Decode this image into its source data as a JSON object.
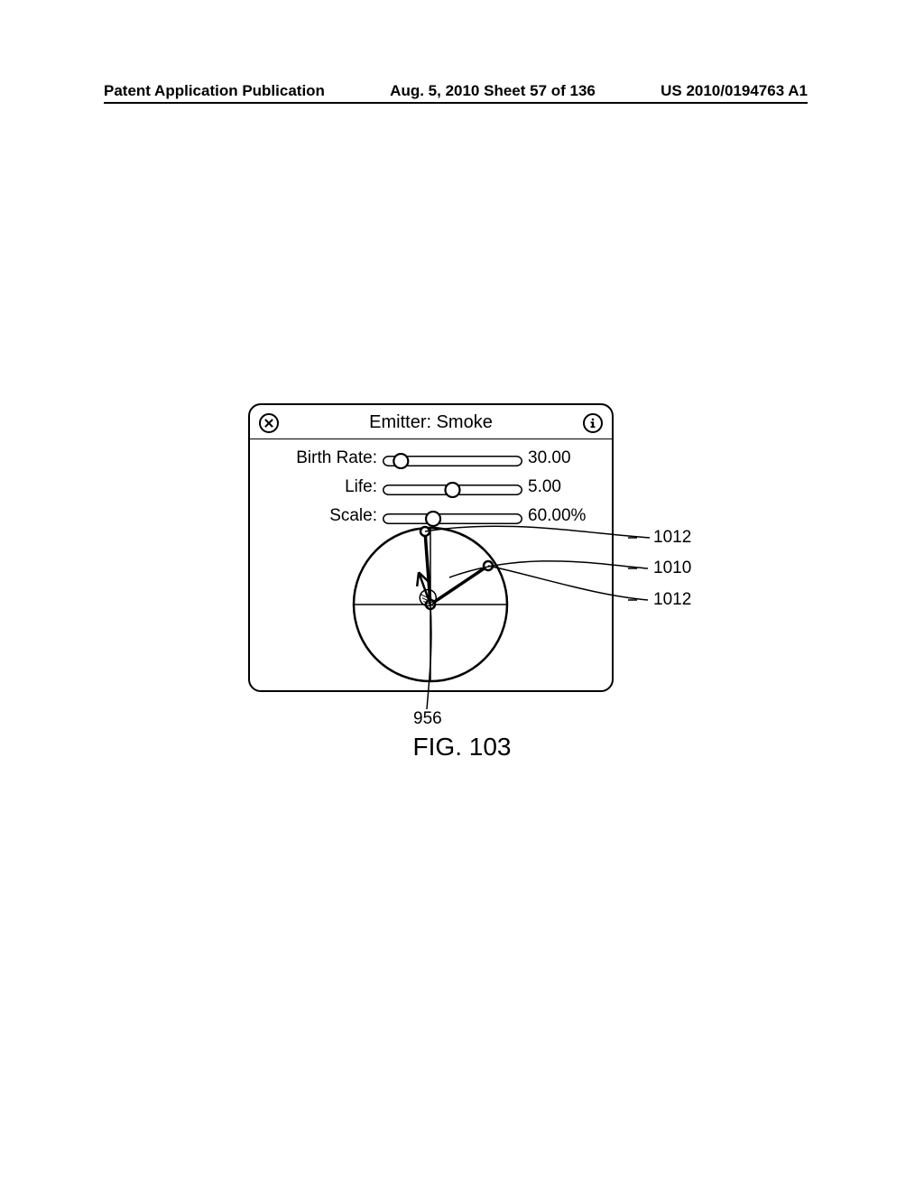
{
  "header": {
    "left": "Patent Application Publication",
    "center": "Aug. 5, 2010  Sheet 57 of 136",
    "right": "US 2010/0194763 A1"
  },
  "panel": {
    "title": "Emitter: Smoke",
    "sliders": {
      "birth_rate": {
        "label": "Birth Rate:",
        "value": "30.00",
        "pos": 0.1
      },
      "life": {
        "label": "Life:",
        "value": "5.00",
        "pos": 0.5
      },
      "scale": {
        "label": "Scale:",
        "value": "60.00%",
        "pos": 0.35
      }
    }
  },
  "refs": {
    "r1012a": "1012",
    "r1010": "1010",
    "r1012b": "1012",
    "r956": "956"
  },
  "figure_num": "FIG. 103"
}
